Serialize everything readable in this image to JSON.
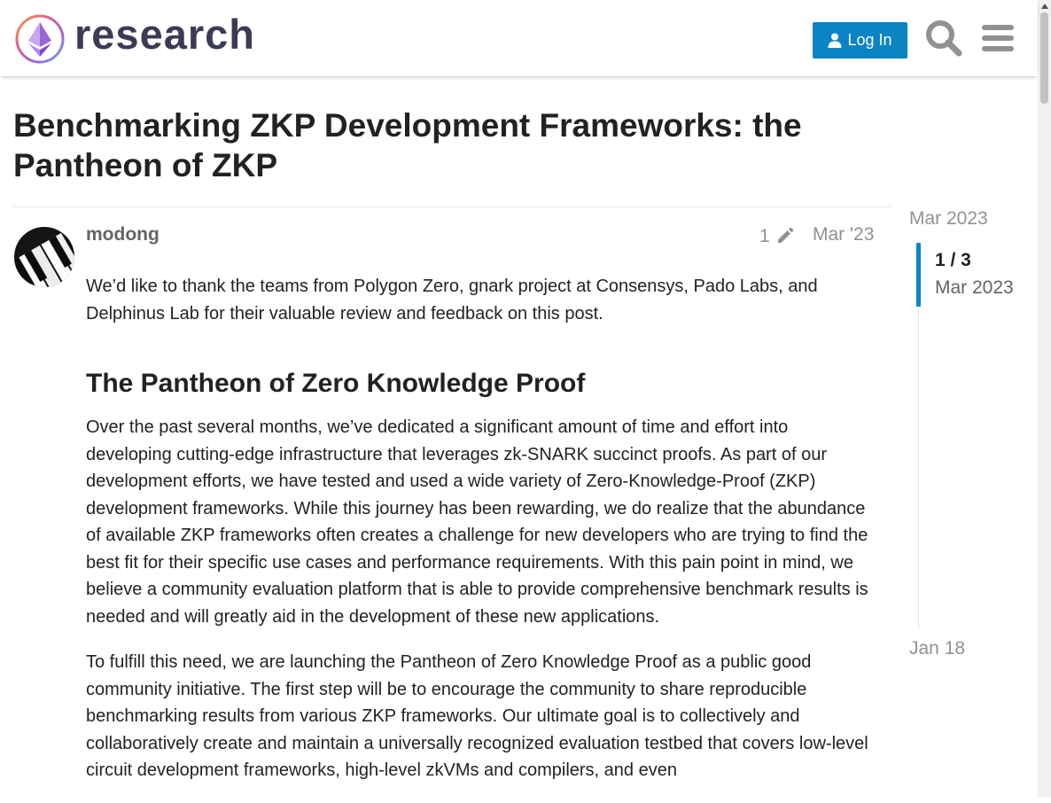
{
  "header": {
    "site_name": "research",
    "login_label": "Log In",
    "icons": [
      "ethereum-logo",
      "user-icon",
      "search-icon",
      "hamburger-menu-icon"
    ]
  },
  "topic": {
    "title": "Benchmarking ZKP Development Frameworks: the Pantheon of ZKP"
  },
  "post": {
    "username": "modong",
    "edit_count": "1",
    "date": "Mar '23",
    "paragraph_1": "We’d like to thank the teams from Polygon Zero, gnark project at Consensys, Pado Labs, and Delphinus Lab for their valuable review and feedback on this post.",
    "heading": "The Pantheon of Zero Knowledge Proof",
    "paragraph_2": "Over the past several months, we’ve dedicated a significant amount of time and effort into developing cutting-edge infrastructure that leverages zk-SNARK succinct proofs. As part of our development efforts, we have tested and used a wide variety of Zero-Knowledge-Proof (ZKP) development frameworks. While this journey has been rewarding, we do realize that the abundance of available ZKP frameworks often creates a challenge for new developers who are trying to find the best fit for their specific use cases and performance requirements. With this pain point in mind, we believe a community evaluation platform that is able to provide comprehensive benchmark results is needed and will greatly aid in the development of these new applications.",
    "paragraph_3": "To fulfill this need, we are launching the Pantheon of Zero Knowledge Proof as a public good community initiative. The first step will be to encourage the community to share reproducible benchmarking results from various ZKP frameworks. Our ultimate goal is to collectively and collaboratively create and maintain a universally recognized evaluation testbed that covers low-level circuit development frameworks, high-level zkVMs and compilers, and even"
  },
  "timeline": {
    "start_date": "Mar 2023",
    "progress": "1 / 3",
    "current_date": "Mar 2023",
    "end_date": "Jan 18"
  },
  "colors": {
    "accent": "#0a84c4",
    "muted_text": "#919191",
    "username": "#646464",
    "logo_text": "#3b3b55"
  }
}
